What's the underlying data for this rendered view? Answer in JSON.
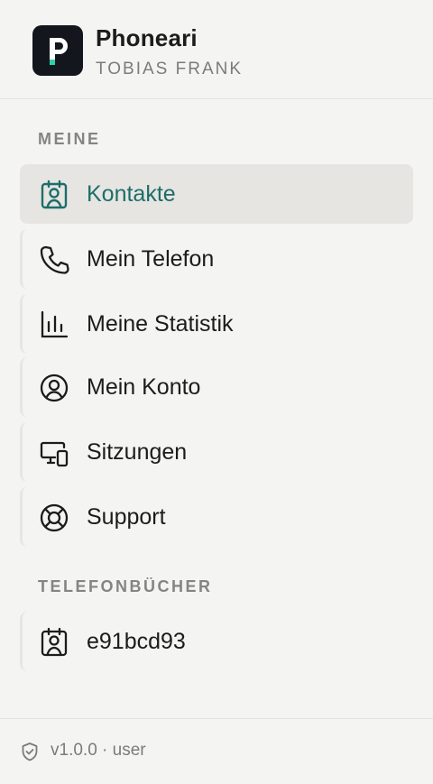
{
  "app": {
    "name": "Phoneari",
    "user": "TOBIAS FRANK",
    "logo_letter": "P"
  },
  "sections": {
    "meine": "MEINE",
    "telefonbuecher": "TELEFONBÜCHER"
  },
  "nav": {
    "kontakte": "Kontakte",
    "telefon": "Mein Telefon",
    "statistik": "Meine Statistik",
    "konto": "Mein Konto",
    "sitzungen": "Sitzungen",
    "support": "Support"
  },
  "phonebooks": {
    "item_0": "e91bcd93"
  },
  "footer": {
    "version": "v1.0.0 · user"
  },
  "colors": {
    "accent": "#1e6e68",
    "logo_bg": "#13171d",
    "logo_accent": "#2fd0a8"
  }
}
